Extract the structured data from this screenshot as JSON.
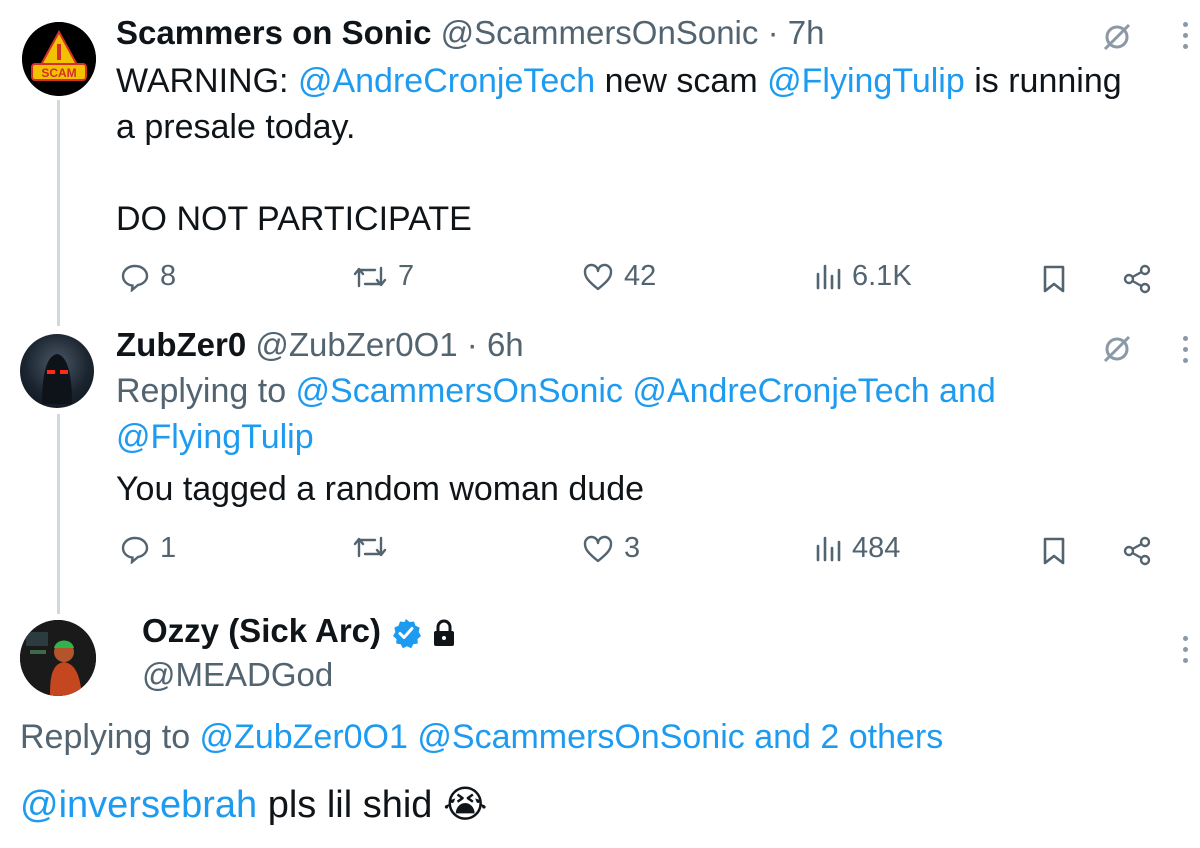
{
  "tweet1": {
    "name": "Scammers on Sonic",
    "handle": "@ScammersOnSonic",
    "time": "· 7h",
    "avatar_label": "SCAM",
    "text_prefix": "WARNING: ",
    "mention1": "@AndreCronjeTech",
    "text_mid": " new scam ",
    "mention2": "@FlyingTulip",
    "text_suffix": " is running",
    "text_line2": "a presale today.",
    "text_line3": "DO NOT PARTICIPATE",
    "replies": "8",
    "reposts": "7",
    "likes": "42",
    "views": "6.1K"
  },
  "tweet2": {
    "name": "ZubZer0",
    "handle": "@ZubZer0O1",
    "time": "· 6h",
    "replying_label": "Replying to ",
    "replying_mention1": "@ScammersOnSonic",
    "replying_mention2": "@AndreCronjeTech",
    "replying_and": " and",
    "replying_mention3": "@FlyingTulip",
    "text": "You tagged a random woman dude",
    "replies": "1",
    "reposts": "",
    "likes": "3",
    "views": "484"
  },
  "tweet3": {
    "name": "Ozzy (Sick Arc)",
    "handle": "@MEADGod",
    "replying_label": "Replying to ",
    "replying_mention1": "@ZubZer0O1",
    "replying_mention2": "@ScammersOnSonic",
    "replying_others": " and 2 others",
    "text_mention": "@inversebrah",
    "text": " pls lil shid",
    "emoji": "😭"
  },
  "colors": {
    "accent": "#1d9bf0",
    "muted": "#536471",
    "text": "#0f1419",
    "line": "#cfd9de"
  }
}
